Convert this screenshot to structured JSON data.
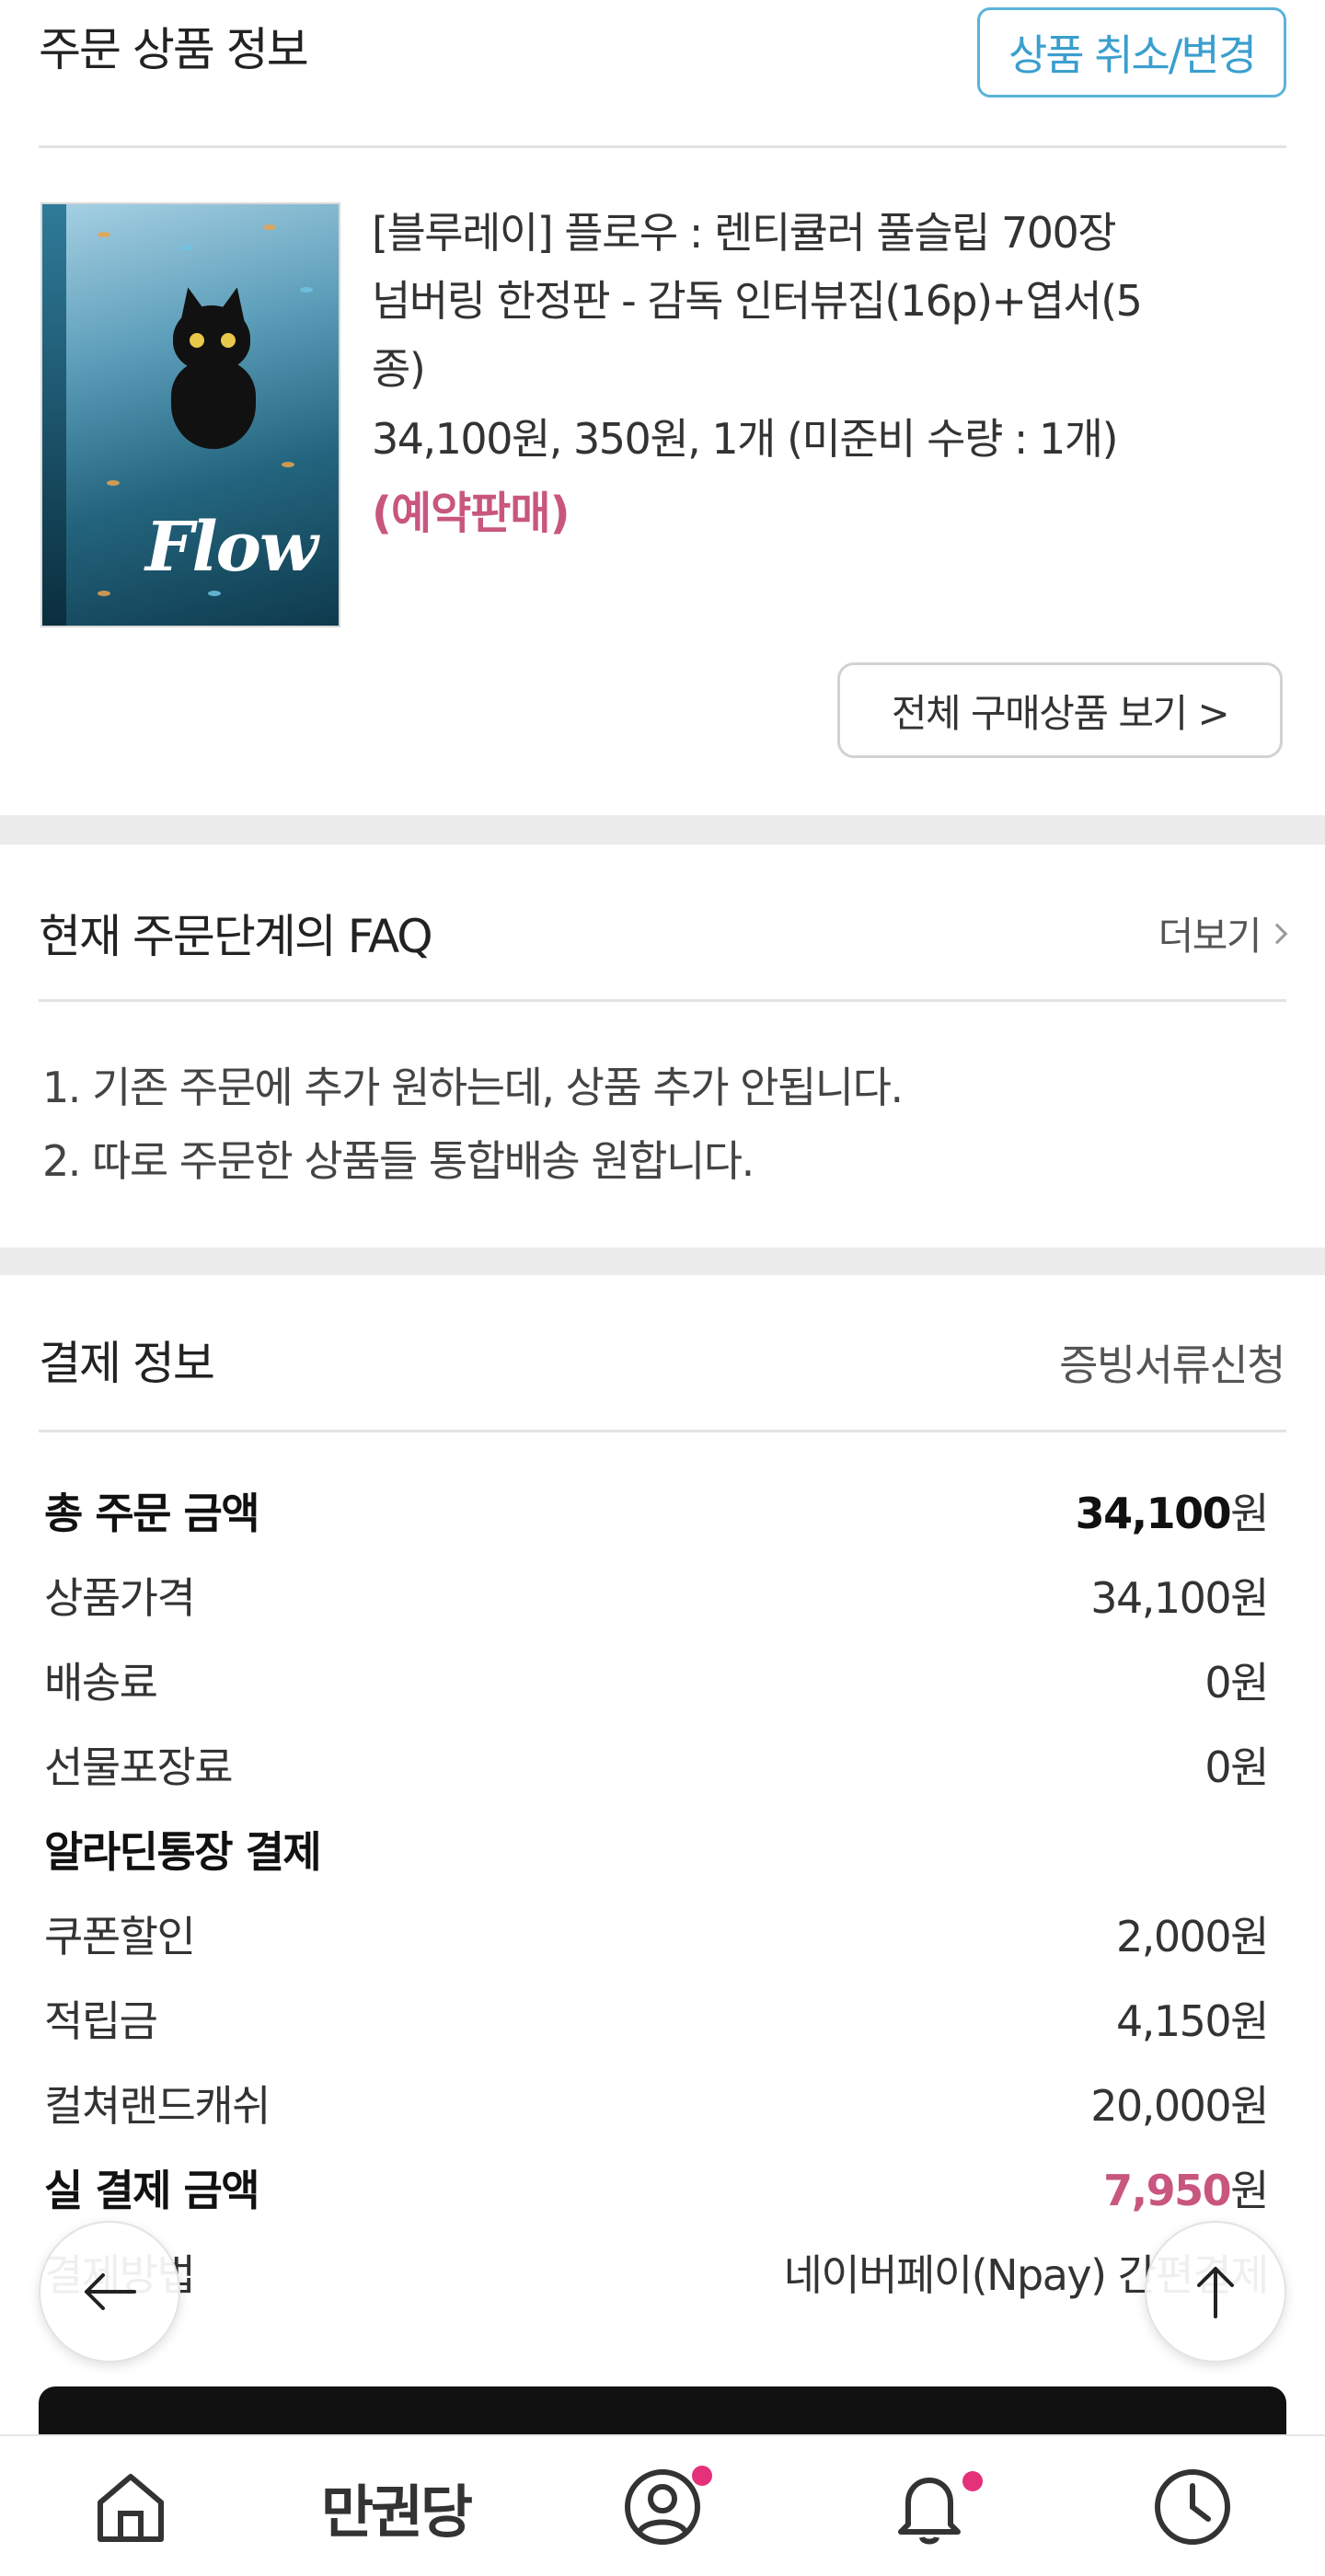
{
  "order": {
    "title": "주문 상품 정보",
    "cancel_change_button": "상품 취소/변경",
    "product": {
      "cover_logo": "Flow",
      "name_line1": "[블루레이] 플로우 : 렌티큘러 풀슬립 700장",
      "name_line2": "넘버링 한정판 - 감독 인터뷰집(16p)+엽서(5",
      "name_line3": "종)",
      "price_line": "34,100원, 350원, 1개 (미준비 수량 : 1개)",
      "status": "(예약판매)"
    },
    "view_all_button": "전체 구매상품 보기 >"
  },
  "faq": {
    "title": "현재 주문단계의 FAQ",
    "more": "더보기",
    "items": [
      "1. 기존 주문에 추가 원하는데, 상품 추가 안됩니다.",
      "2. 따로 주문한 상품들 통합배송 원합니다."
    ]
  },
  "payment": {
    "title": "결제 정보",
    "receipt_link": "증빙서류신청",
    "total_label": "총 주문 금액",
    "total_value": "34,100",
    "product_price_label": "상품가격",
    "product_price_value": "34,100원",
    "shipping_label": "배송료",
    "shipping_value": "0원",
    "gift_wrap_label": "선물포장료",
    "gift_wrap_value": "0원",
    "bank_pay_label": "알라딘통장 결제",
    "coupon_label": "쿠폰할인",
    "coupon_value": "2,000원",
    "points_label": "적립금",
    "points_value": "4,150원",
    "cultureland_label": "컬쳐랜드캐쉬",
    "cultureland_value": "20,000원",
    "final_label": "실 결제 금액",
    "final_value": "7,950",
    "method_label": "결제방법",
    "method_value": "네이버페이(Npay) 간편결제",
    "won": "원"
  },
  "nav": {
    "brand": "만권당",
    "icons": [
      "home-icon",
      "profile-icon",
      "bell-icon",
      "clock-icon"
    ]
  },
  "colors": {
    "accent_blue": "#3a9fce",
    "accent_pink": "#c8567f",
    "badge_dot": "#e5317a"
  }
}
